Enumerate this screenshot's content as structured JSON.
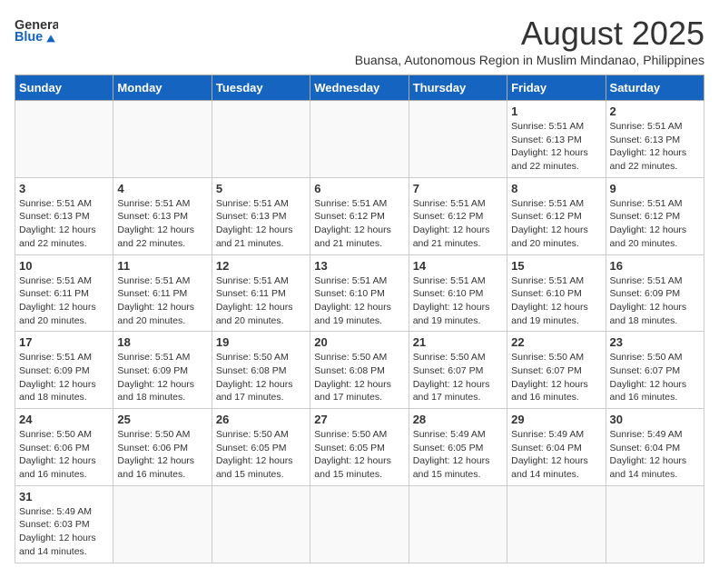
{
  "header": {
    "logo_general": "General",
    "logo_blue": "Blue",
    "title": "August 2025",
    "subtitle": "Buansa, Autonomous Region in Muslim Mindanao, Philippines"
  },
  "weekdays": [
    "Sunday",
    "Monday",
    "Tuesday",
    "Wednesday",
    "Thursday",
    "Friday",
    "Saturday"
  ],
  "weeks": [
    [
      {
        "day": "",
        "info": ""
      },
      {
        "day": "",
        "info": ""
      },
      {
        "day": "",
        "info": ""
      },
      {
        "day": "",
        "info": ""
      },
      {
        "day": "",
        "info": ""
      },
      {
        "day": "1",
        "info": "Sunrise: 5:51 AM\nSunset: 6:13 PM\nDaylight: 12 hours\nand 22 minutes."
      },
      {
        "day": "2",
        "info": "Sunrise: 5:51 AM\nSunset: 6:13 PM\nDaylight: 12 hours\nand 22 minutes."
      }
    ],
    [
      {
        "day": "3",
        "info": "Sunrise: 5:51 AM\nSunset: 6:13 PM\nDaylight: 12 hours\nand 22 minutes."
      },
      {
        "day": "4",
        "info": "Sunrise: 5:51 AM\nSunset: 6:13 PM\nDaylight: 12 hours\nand 22 minutes."
      },
      {
        "day": "5",
        "info": "Sunrise: 5:51 AM\nSunset: 6:13 PM\nDaylight: 12 hours\nand 21 minutes."
      },
      {
        "day": "6",
        "info": "Sunrise: 5:51 AM\nSunset: 6:12 PM\nDaylight: 12 hours\nand 21 minutes."
      },
      {
        "day": "7",
        "info": "Sunrise: 5:51 AM\nSunset: 6:12 PM\nDaylight: 12 hours\nand 21 minutes."
      },
      {
        "day": "8",
        "info": "Sunrise: 5:51 AM\nSunset: 6:12 PM\nDaylight: 12 hours\nand 20 minutes."
      },
      {
        "day": "9",
        "info": "Sunrise: 5:51 AM\nSunset: 6:12 PM\nDaylight: 12 hours\nand 20 minutes."
      }
    ],
    [
      {
        "day": "10",
        "info": "Sunrise: 5:51 AM\nSunset: 6:11 PM\nDaylight: 12 hours\nand 20 minutes."
      },
      {
        "day": "11",
        "info": "Sunrise: 5:51 AM\nSunset: 6:11 PM\nDaylight: 12 hours\nand 20 minutes."
      },
      {
        "day": "12",
        "info": "Sunrise: 5:51 AM\nSunset: 6:11 PM\nDaylight: 12 hours\nand 20 minutes."
      },
      {
        "day": "13",
        "info": "Sunrise: 5:51 AM\nSunset: 6:10 PM\nDaylight: 12 hours\nand 19 minutes."
      },
      {
        "day": "14",
        "info": "Sunrise: 5:51 AM\nSunset: 6:10 PM\nDaylight: 12 hours\nand 19 minutes."
      },
      {
        "day": "15",
        "info": "Sunrise: 5:51 AM\nSunset: 6:10 PM\nDaylight: 12 hours\nand 19 minutes."
      },
      {
        "day": "16",
        "info": "Sunrise: 5:51 AM\nSunset: 6:09 PM\nDaylight: 12 hours\nand 18 minutes."
      }
    ],
    [
      {
        "day": "17",
        "info": "Sunrise: 5:51 AM\nSunset: 6:09 PM\nDaylight: 12 hours\nand 18 minutes."
      },
      {
        "day": "18",
        "info": "Sunrise: 5:51 AM\nSunset: 6:09 PM\nDaylight: 12 hours\nand 18 minutes."
      },
      {
        "day": "19",
        "info": "Sunrise: 5:50 AM\nSunset: 6:08 PM\nDaylight: 12 hours\nand 17 minutes."
      },
      {
        "day": "20",
        "info": "Sunrise: 5:50 AM\nSunset: 6:08 PM\nDaylight: 12 hours\nand 17 minutes."
      },
      {
        "day": "21",
        "info": "Sunrise: 5:50 AM\nSunset: 6:07 PM\nDaylight: 12 hours\nand 17 minutes."
      },
      {
        "day": "22",
        "info": "Sunrise: 5:50 AM\nSunset: 6:07 PM\nDaylight: 12 hours\nand 16 minutes."
      },
      {
        "day": "23",
        "info": "Sunrise: 5:50 AM\nSunset: 6:07 PM\nDaylight: 12 hours\nand 16 minutes."
      }
    ],
    [
      {
        "day": "24",
        "info": "Sunrise: 5:50 AM\nSunset: 6:06 PM\nDaylight: 12 hours\nand 16 minutes."
      },
      {
        "day": "25",
        "info": "Sunrise: 5:50 AM\nSunset: 6:06 PM\nDaylight: 12 hours\nand 16 minutes."
      },
      {
        "day": "26",
        "info": "Sunrise: 5:50 AM\nSunset: 6:05 PM\nDaylight: 12 hours\nand 15 minutes."
      },
      {
        "day": "27",
        "info": "Sunrise: 5:50 AM\nSunset: 6:05 PM\nDaylight: 12 hours\nand 15 minutes."
      },
      {
        "day": "28",
        "info": "Sunrise: 5:49 AM\nSunset: 6:05 PM\nDaylight: 12 hours\nand 15 minutes."
      },
      {
        "day": "29",
        "info": "Sunrise: 5:49 AM\nSunset: 6:04 PM\nDaylight: 12 hours\nand 14 minutes."
      },
      {
        "day": "30",
        "info": "Sunrise: 5:49 AM\nSunset: 6:04 PM\nDaylight: 12 hours\nand 14 minutes."
      }
    ],
    [
      {
        "day": "31",
        "info": "Sunrise: 5:49 AM\nSunset: 6:03 PM\nDaylight: 12 hours\nand 14 minutes."
      },
      {
        "day": "",
        "info": ""
      },
      {
        "day": "",
        "info": ""
      },
      {
        "day": "",
        "info": ""
      },
      {
        "day": "",
        "info": ""
      },
      {
        "day": "",
        "info": ""
      },
      {
        "day": "",
        "info": ""
      }
    ]
  ]
}
